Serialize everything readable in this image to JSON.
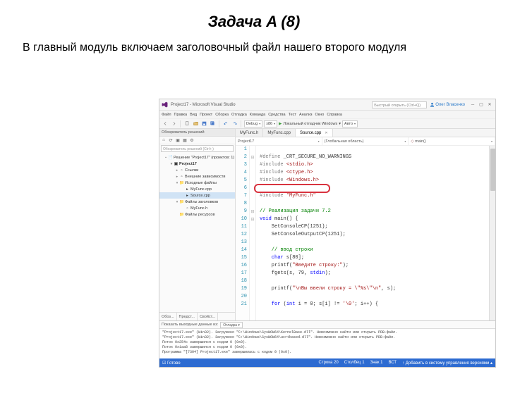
{
  "slide": {
    "title": "Задача A (8)",
    "subtitle": "В главный модуль включаем заголовочный файл нашего второго модуля"
  },
  "titlebar": {
    "project": "Project17 - Microsoft Visual Studio",
    "search_placeholder": "Быстрый открыть (Ctrl+Q)",
    "user": "Олег Власенко"
  },
  "menu": [
    "Файл",
    "Правка",
    "Вид",
    "Проект",
    "Сборка",
    "Отладка",
    "Команда",
    "Средства",
    "Тест",
    "Анализ",
    "Окно",
    "Справка"
  ],
  "toolbar": {
    "config": "Debug",
    "platform": "x86",
    "run_label": "Локальный отладчик Windows",
    "auto": "Авто"
  },
  "solution": {
    "header": "Обозреватель решений",
    "search_placeholder": "Обозреватель решений (Ctrl+;)",
    "tree": {
      "sol": "Решение \"Project17\" (проектов: 1)",
      "proj": "Project17",
      "refs": "Ссылки",
      "ext": "Внешние зависимости",
      "src": "Исходные файлы",
      "main": "MyFunc.cpp",
      "source": "Source.cpp",
      "hdrfolder": "Файлы заголовков",
      "hdr": "MyFunc.h",
      "res": "Файлы ресурсов"
    },
    "tabs": [
      "Обоз...",
      "Предст...",
      "Свойст..."
    ]
  },
  "tabs": {
    "t1": "MyFunc.h",
    "t2": "MyFunc.cpp",
    "active": "Source.cpp"
  },
  "navcombo": {
    "a": "Project17",
    "b": "(Глобальная область)",
    "c": "main()"
  },
  "code": {
    "l1": {
      "a": "#define ",
      "b": "_CRT_SECURE_NO_WARNINGS"
    },
    "l2": {
      "a": "#include ",
      "b": "<stdio.h>"
    },
    "l3": {
      "a": "#include ",
      "b": "<ctype.h>"
    },
    "l4": {
      "a": "#include ",
      "b": "<Windows.h>"
    },
    "l6": {
      "a": "#include ",
      "b": "\"MyFunc.h\""
    },
    "l8": "// Реализация задачи 7.2",
    "l9": {
      "a": "void",
      "b": " main() {"
    },
    "l11": "    SetConsoleCP(1251);",
    "l12": "    SetConsoleOutputCP(1251);",
    "l14": "    // ввод строки",
    "l15": {
      "a": "    char",
      "b": " s[80];"
    },
    "l16": {
      "a": "    printf(",
      "b": "\"Введите строку:\"",
      "c": ");"
    },
    "l17": {
      "a": "    fgets(s, 79, ",
      "b": "stdin",
      "c": ");"
    },
    "l19": {
      "a": "    printf(",
      "b": "\"\\nВы ввели строку = \\\"%s\\\"\\n\"",
      "c": ", s);"
    },
    "l21": {
      "a": "    for",
      "b": " (",
      "c": "int",
      "d": " i = 0; s[i] != ",
      "e": "'\\0'",
      "f": "; i++) {"
    }
  },
  "output": {
    "header": "Показать выходные данные из:",
    "combo": "Отладка",
    "lines": [
      "\"Project17.exe\" (Win32). Загружено \"C:\\Windows\\SysWOW64\\KernelBase.dll\". Невозможно найти или открыть PDB-файл.",
      "\"Project17.exe\" (Win32). Загружено \"C:\\Windows\\SysWOW64\\ucrtbased.dll\". Невозможно найти или открыть PDB-файл.",
      "Поток 0x254c завершился с кодом 0 (0x0).",
      "Поток 0x1aa8 завершился с кодом 0 (0x0).",
      "Программа \"[7304] Project17.exe\" завершилась с кодом 0 (0x0)."
    ]
  },
  "status": {
    "ready": "Готово",
    "line": "Строка 20",
    "col": "Столбец 1",
    "ch": "Знак 1",
    "mode": "ВСТ",
    "publish": "Добавить в систему управления версиями"
  }
}
